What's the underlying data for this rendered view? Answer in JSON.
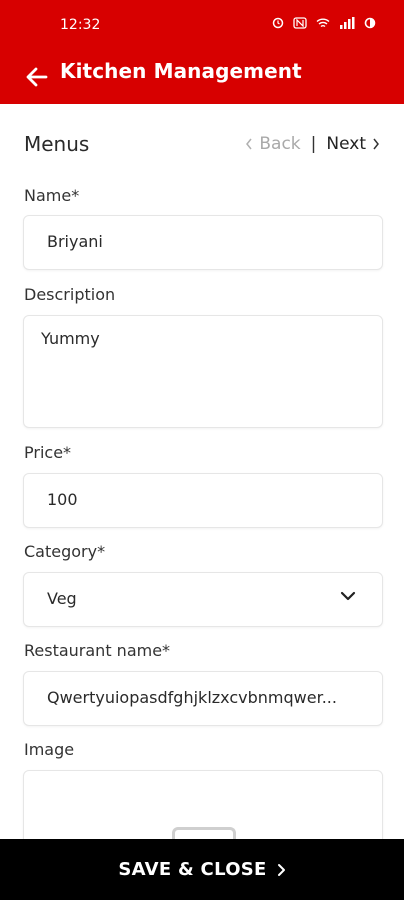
{
  "status_bar": {
    "time": "12:32",
    "icons": [
      "alarm-icon",
      "nfc-icon",
      "wifi-icon",
      "signal-icon",
      "battery-icon"
    ]
  },
  "app_bar": {
    "title": "Kitchen Management",
    "background": "#d70000"
  },
  "form": {
    "title": "Menus",
    "pager": {
      "back_label": "Back",
      "next_label": "Next"
    },
    "name": {
      "label": "Name*",
      "value": "Briyani"
    },
    "description": {
      "label": "Description",
      "value": "Yummy"
    },
    "price": {
      "label": "Price*",
      "value": "100"
    },
    "category": {
      "label": "Category*",
      "value": "Veg"
    },
    "restaurant": {
      "label": "Restaurant name*",
      "value": "Qwertyuiopasdfghjklzxcvbnmqwer..."
    },
    "image": {
      "label": "Image"
    }
  },
  "footer": {
    "save_close_label": "SAVE & CLOSE"
  }
}
